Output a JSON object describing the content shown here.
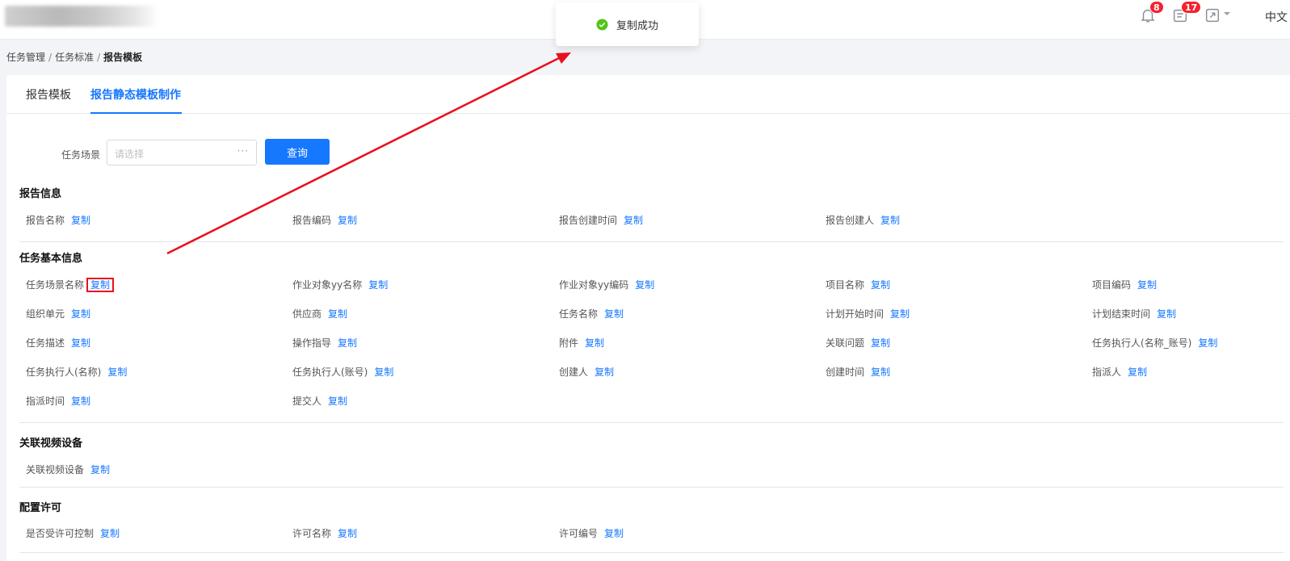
{
  "topbar": {
    "notifications_count": "8",
    "tasks_count": "17",
    "language": "中文"
  },
  "toast": {
    "message": "复制成功"
  },
  "breadcrumb": {
    "items": [
      "任务管理",
      "任务标准",
      "报告模板"
    ]
  },
  "tabs": [
    {
      "label": "报告模板"
    },
    {
      "label": "报告静态模板制作"
    }
  ],
  "search": {
    "label": "任务场景",
    "placeholder": "请选择",
    "button": "查询"
  },
  "copy_label": "复制",
  "sections": [
    {
      "title": "报告信息",
      "fields": [
        "报告名称",
        "报告编码",
        "报告创建时间",
        "报告创建人"
      ]
    },
    {
      "title": "任务基本信息",
      "fields": [
        "任务场景名称",
        "作业对象yy名称",
        "作业对象yy编码",
        "项目名称",
        "项目编码",
        "组织单元",
        "供应商",
        "任务名称",
        "计划开始时间",
        "计划结束时间",
        "任务描述",
        "操作指导",
        "附件",
        "关联问题",
        "任务执行人(名称_账号)",
        "任务执行人(名称)",
        "任务执行人(账号)",
        "创建人",
        "创建时间",
        "指派人",
        "指派时间",
        "提交人"
      ]
    },
    {
      "title": "关联视频设备",
      "fields": [
        "关联视频设备"
      ]
    },
    {
      "title": "配置许可",
      "fields": [
        "是否受许可控制",
        "许可名称",
        "许可编号"
      ]
    }
  ],
  "colors": {
    "primary": "#1677ff",
    "badge": "#f5222d",
    "annotation": "#e8101f",
    "success": "#52c41a"
  }
}
